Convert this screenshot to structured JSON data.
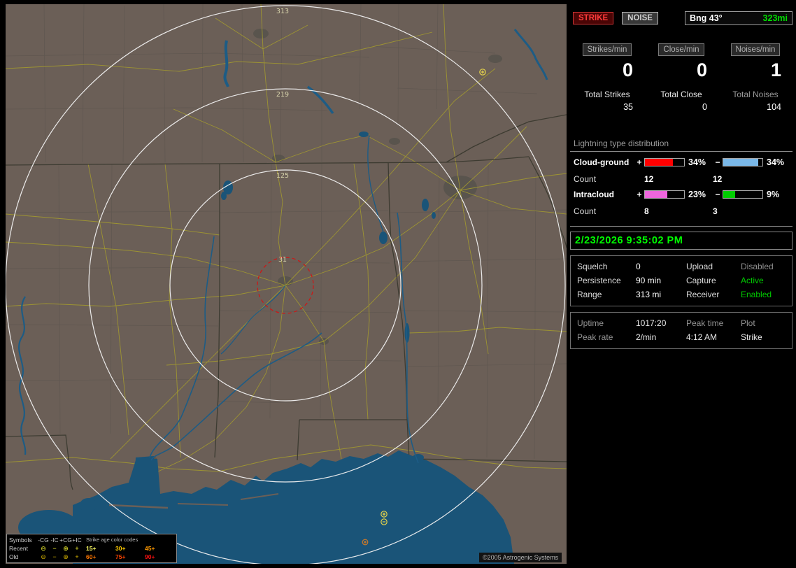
{
  "map": {
    "ring_labels": [
      {
        "text": "313"
      },
      {
        "text": "219"
      },
      {
        "text": "125"
      },
      {
        "text": "31"
      }
    ],
    "copyright": "©2005 Astrogenic Systems",
    "legend": {
      "headers": [
        "Symbols",
        "-CG",
        "-IC",
        "+CG",
        "+IC"
      ],
      "age_title": "Strike age color codes",
      "symbol_rows": [
        {
          "label": "Recent",
          "color": "#ffff33",
          "symbols": [
            {
              "glyph": "⊖"
            },
            {
              "glyph": "−"
            },
            {
              "glyph": "⊕"
            },
            {
              "glyph": "+"
            }
          ]
        },
        {
          "label": "Old",
          "color": "#d8b400",
          "symbols": [
            {
              "glyph": "⊖"
            },
            {
              "glyph": "−"
            },
            {
              "glyph": "⊕"
            },
            {
              "glyph": "+"
            }
          ]
        }
      ],
      "age_codes": [
        {
          "label": "15+",
          "color": "#ffff66"
        },
        {
          "label": "30+",
          "color": "#ffcc00"
        },
        {
          "label": "45+",
          "color": "#ff9900"
        },
        {
          "label": "60+",
          "color": "#ff7700"
        },
        {
          "label": "75+",
          "color": "#ff4400"
        },
        {
          "label": "90+",
          "color": "#ff1111"
        }
      ]
    }
  },
  "toolbar": {
    "strike": "STRIKE",
    "noise": "NOISE",
    "bearing": "Bng 43°",
    "distance": "323mi"
  },
  "rates": [
    {
      "header": "Strikes/min",
      "value": "0"
    },
    {
      "header": "Close/min",
      "value": "0"
    },
    {
      "header": "Noises/min",
      "value": "1"
    }
  ],
  "totals": [
    {
      "label": "Total Strikes",
      "value": "35"
    },
    {
      "label": "Total Close",
      "value": "0"
    },
    {
      "label": "Total Noises",
      "value": "104"
    }
  ],
  "distribution": {
    "title": "Lightning type distribution",
    "rows": [
      {
        "label": "Cloud-ground",
        "plus": "+",
        "plus_pct": "34%",
        "plus_color": "#ff0000",
        "plus_fill": 72,
        "minus": "−",
        "minus_pct": "34%",
        "minus_color": "#7ab8e8",
        "minus_fill": 90,
        "count_label": "Count",
        "plus_count": "12",
        "minus_count": "12"
      },
      {
        "label": "Intracloud",
        "plus": "+",
        "plus_pct": "23%",
        "plus_color": "#ee66dd",
        "plus_fill": 58,
        "minus": "−",
        "minus_pct": "9%",
        "minus_color": "#00cc00",
        "minus_fill": 30,
        "count_label": "Count",
        "plus_count": "8",
        "minus_count": "3"
      }
    ]
  },
  "clock": {
    "datetime": "2/23/2026 9:35:02 PM"
  },
  "settings": {
    "rows": [
      {
        "l1": "Squelch",
        "v1": "0",
        "l2": "Upload",
        "v2": "Disabled",
        "v2_state": "disabled"
      },
      {
        "l1": "Persistence",
        "v1": "90 min",
        "l2": "Capture",
        "v2": "Active",
        "v2_state": "active"
      },
      {
        "l1": "Range",
        "v1": "313 mi",
        "l2": "Receiver",
        "v2": "Enabled",
        "v2_state": "active"
      }
    ]
  },
  "session": {
    "rows": [
      {
        "c1": "Uptime",
        "c2": "1017:20",
        "c3": "Peak time",
        "c4": "Plot"
      },
      {
        "c1": "Peak rate",
        "c2": "2/min",
        "c3": "4:12 AM",
        "c4": "Strike"
      }
    ]
  }
}
